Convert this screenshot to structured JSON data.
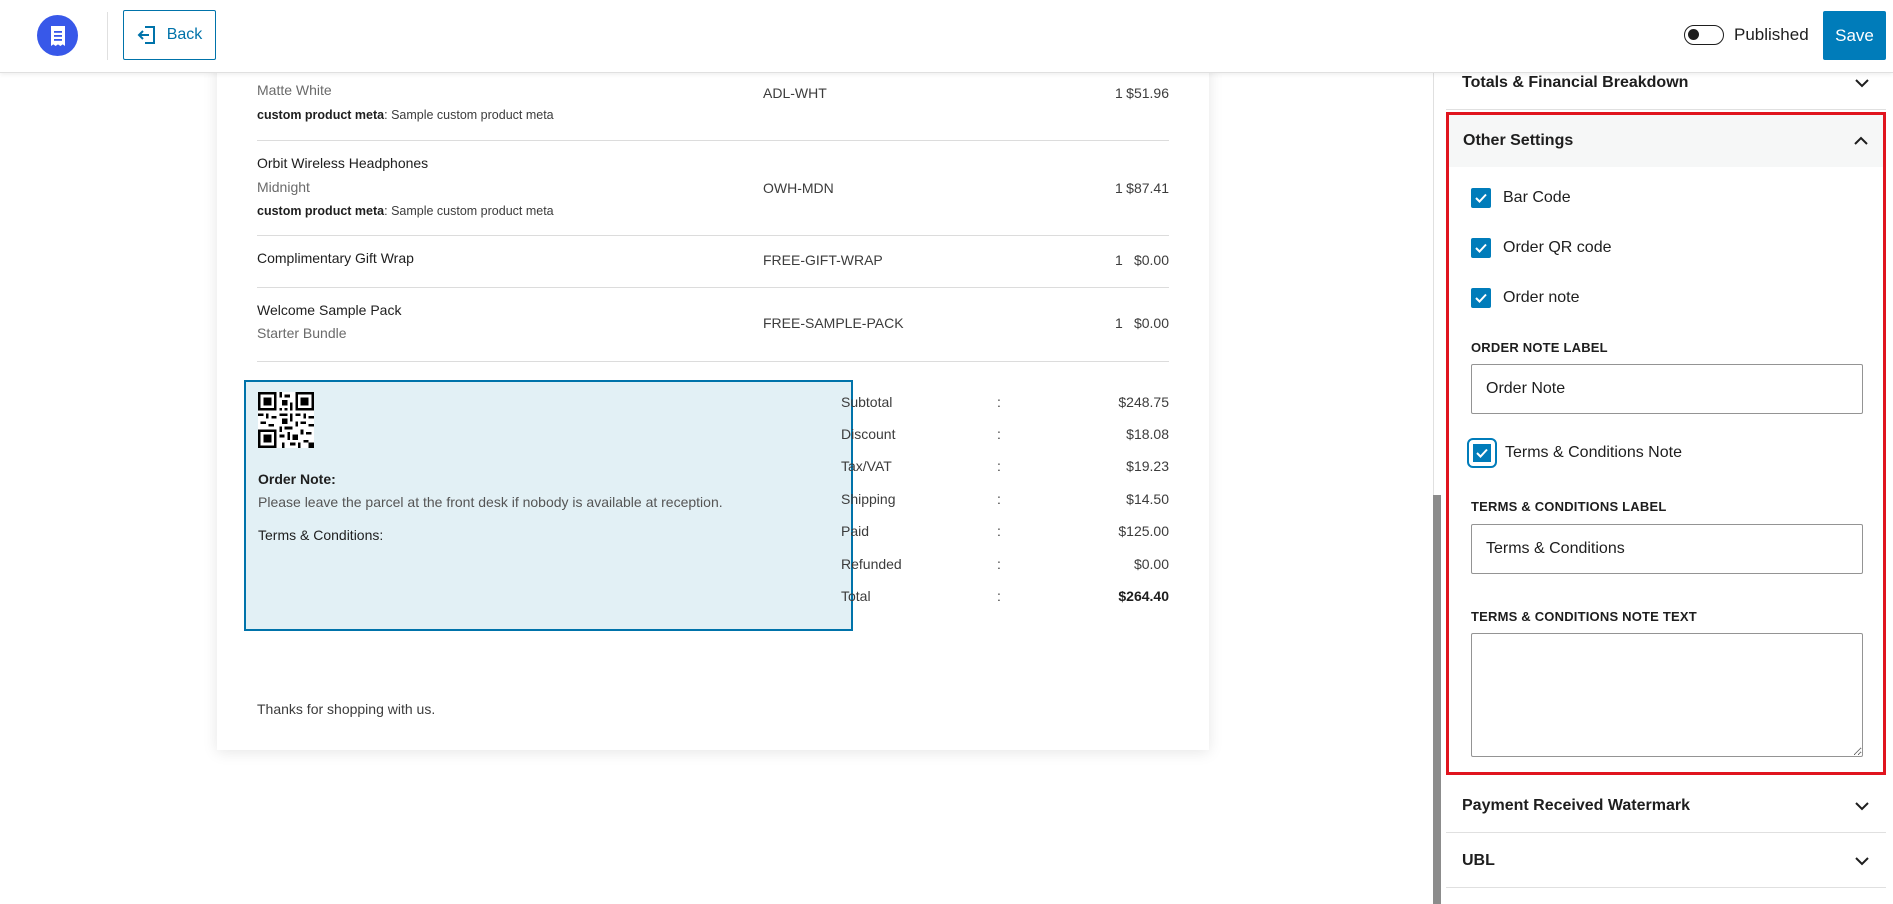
{
  "topbar": {
    "back_label": "Back",
    "published_label": "Published",
    "published_on": false,
    "save_label": "Save"
  },
  "invoice": {
    "items": [
      {
        "name": "",
        "variant": "Matte White",
        "meta_key": "custom product meta",
        "meta_value": "Sample custom product meta",
        "sku": "ADL-WHT",
        "qty": "1",
        "price": "$51.96"
      },
      {
        "name": "Orbit Wireless Headphones",
        "variant": "Midnight",
        "meta_key": "custom product meta",
        "meta_value": "Sample custom product meta",
        "sku": "OWH-MDN",
        "qty": "1",
        "price": "$87.41"
      },
      {
        "name": "Complimentary Gift Wrap",
        "variant": "",
        "meta_key": "",
        "meta_value": "",
        "sku": "FREE-GIFT-WRAP",
        "qty": "1",
        "price": "$0.00"
      },
      {
        "name": "Welcome Sample Pack",
        "variant": "Starter Bundle",
        "meta_key": "",
        "meta_value": "",
        "sku": "FREE-SAMPLE-PACK",
        "qty": "1",
        "price": "$0.00"
      }
    ],
    "order_note_title": "Order Note:",
    "order_note_text": "Please leave the parcel at the front desk if nobody is available at reception.",
    "terms_title": "Terms & Conditions:",
    "totals": [
      {
        "label": "Subtotal",
        "colon": ":",
        "value": "$248.75"
      },
      {
        "label": "Discount",
        "colon": ":",
        "value": "$18.08"
      },
      {
        "label": "Tax/VAT",
        "colon": ":",
        "value": "$19.23"
      },
      {
        "label": "Shipping",
        "colon": ":",
        "value": "$14.50"
      },
      {
        "label": "Paid",
        "colon": ":",
        "value": "$125.00"
      },
      {
        "label": "Refunded",
        "colon": ":",
        "value": "$0.00"
      },
      {
        "label": "Total",
        "colon": ":",
        "value": "$264.40"
      }
    ],
    "thanks": "Thanks for shopping with us."
  },
  "sidebar": {
    "totals_panel_title": "Totals & Financial Breakdown",
    "other_settings": {
      "title": "Other Settings",
      "bar_code_label": "Bar Code",
      "bar_code_checked": true,
      "order_qr_label": "Order QR code",
      "order_qr_checked": true,
      "order_note_label": "Order note",
      "order_note_checked": true,
      "order_note_field_label": "ORDER NOTE LABEL",
      "order_note_field_value": "Order Note",
      "terms_note_label": "Terms & Conditions Note",
      "terms_note_checked": true,
      "terms_field_label": "TERMS & CONDITIONS LABEL",
      "terms_field_value": "Terms & Conditions",
      "terms_text_label": "TERMS & CONDITIONS NOTE TEXT",
      "terms_text_value": ""
    },
    "watermark_panel_title": "Payment Received Watermark",
    "ubl_panel_title": "UBL"
  },
  "colors": {
    "accent": "#007cba",
    "logo": "#3858e9",
    "highlight_border": "#e0141e",
    "notes_bg": "#e2f0f5"
  }
}
